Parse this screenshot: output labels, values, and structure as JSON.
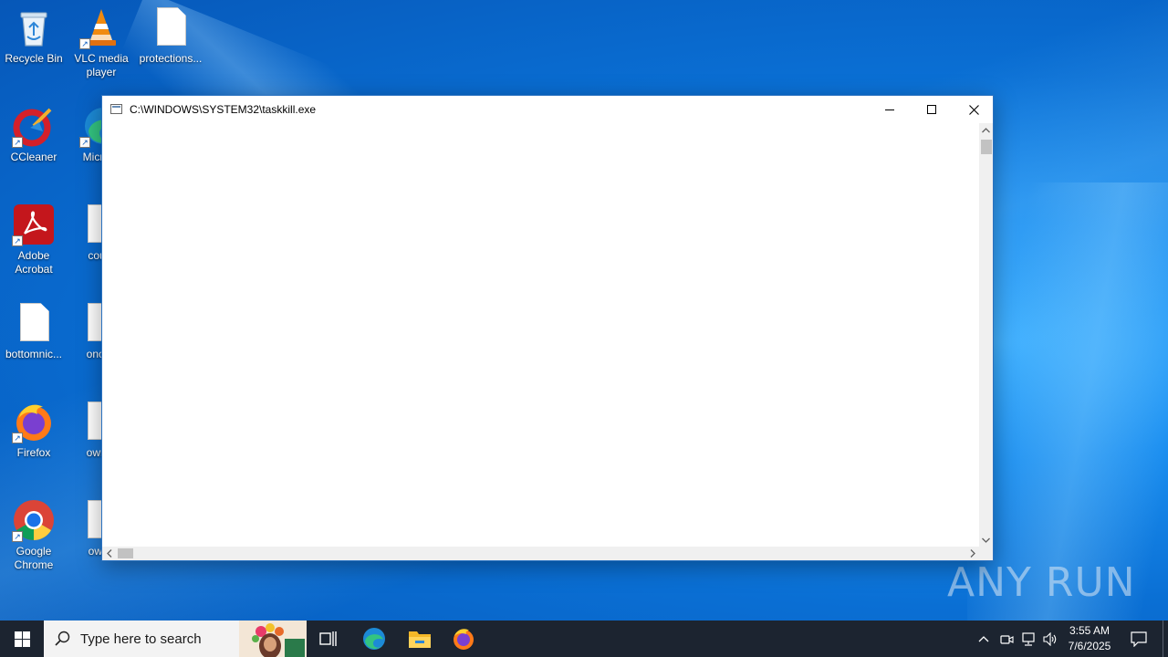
{
  "desktop": {
    "icons": [
      {
        "label": "Recycle Bin",
        "icon": "recycle-bin-icon"
      },
      {
        "label": "VLC media player",
        "icon": "vlc-icon"
      },
      {
        "label": "protections...",
        "icon": "file-icon"
      },
      {
        "label": "CCleaner",
        "icon": "ccleaner-icon"
      },
      {
        "label": "Micr Ed",
        "icon": "edge-icon"
      },
      {
        "label": "Adobe Acrobat",
        "icon": "adobe-acrobat-icon"
      },
      {
        "label": "count",
        "icon": "file-icon"
      },
      {
        "label": "bottomnic...",
        "icon": "file-icon"
      },
      {
        "label": "onceh",
        "icon": "file-icon"
      },
      {
        "label": "Firefox",
        "icon": "firefox-icon"
      },
      {
        "label": "owner",
        "icon": "file-icon"
      },
      {
        "label": "Google Chrome",
        "icon": "chrome-icon"
      },
      {
        "label": "owne",
        "icon": "file-icon"
      }
    ]
  },
  "window": {
    "title": "C:\\WINDOWS\\SYSTEM32\\taskkill.exe",
    "buttons": {
      "minimize": "minimize-icon",
      "maximize": "maximize-icon",
      "close": "close-icon"
    }
  },
  "watermark": {
    "text": "ANY RUN"
  },
  "taskbar": {
    "search_placeholder": "Type here to search",
    "apps": [
      "task-view-icon",
      "edge-icon",
      "file-explorer-icon",
      "firefox-icon"
    ],
    "clock": {
      "time": "3:55 AM",
      "date": "7/6/2025"
    }
  },
  "colors": {
    "accent": "#0078d7",
    "taskbar": "#1c2430",
    "wallpaper": "#0a6fd4"
  }
}
